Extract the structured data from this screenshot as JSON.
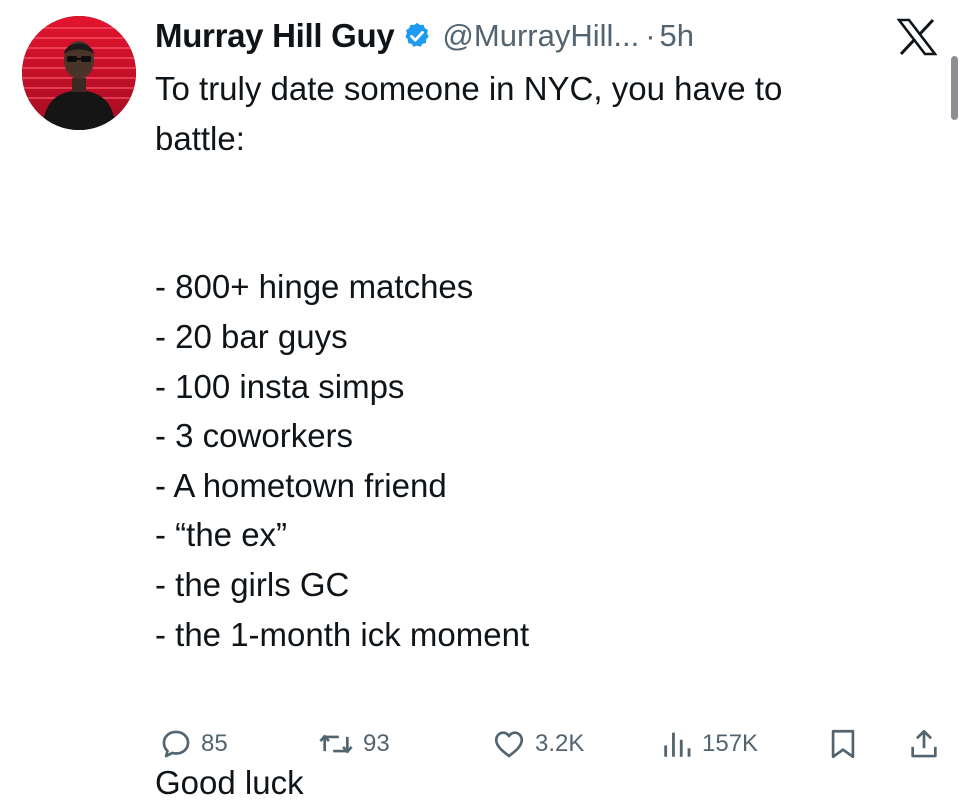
{
  "tweet": {
    "author": {
      "display_name": "Murray Hill Guy",
      "handle": "@MurrayHill...",
      "verified": true,
      "avatar_icon": "avatar-photo"
    },
    "separator": "·",
    "time": "5h",
    "text_intro": [
      "To truly date someone in NYC, you have to",
      "battle:"
    ],
    "list_items": [
      "- 800+ hinge matches",
      "- 20 bar guys",
      "- 100 insta simps",
      "- 3 coworkers",
      "- A hometown friend",
      "- “the ex”",
      "- the girls GC",
      "- the 1-month ick moment"
    ],
    "closing": "Good luck",
    "stats": {
      "replies": "85",
      "reposts": "93",
      "likes": "3.2K",
      "views": "157K"
    }
  },
  "colors": {
    "text": "#0f1419",
    "secondary": "#536471",
    "verified_blue": "#1d9bf0",
    "avatar_bg": "#c8102e"
  },
  "icons": [
    "x-logo-icon",
    "verified-badge-icon",
    "reply-icon",
    "repost-icon",
    "like-icon",
    "views-icon",
    "bookmark-icon",
    "share-icon"
  ]
}
